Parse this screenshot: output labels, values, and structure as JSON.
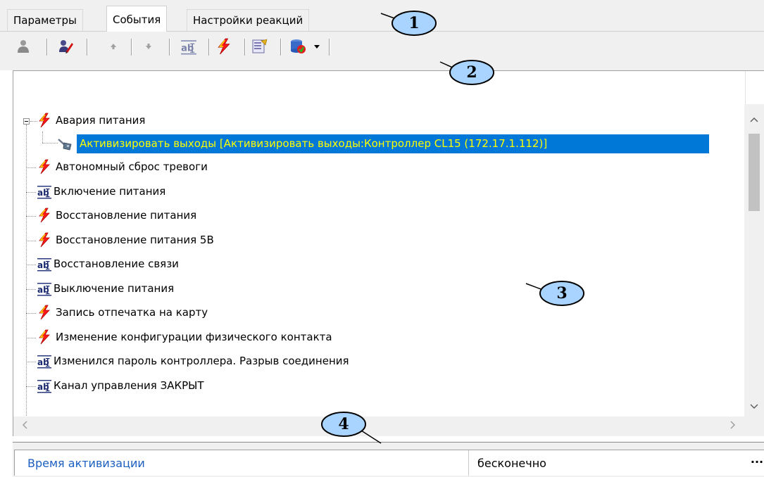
{
  "tabs": [
    {
      "label": "Параметры"
    },
    {
      "label": "События"
    },
    {
      "label": "Настройки реакций"
    }
  ],
  "callouts": [
    "1",
    "2",
    "3",
    "4"
  ],
  "toolbar": {
    "buttons": [
      "person-icon",
      "edit-icon",
      "move-up-icon",
      "move-down-icon",
      "text-event-icon",
      "lightning-icon",
      "properties-icon",
      "database-icon"
    ]
  },
  "tree": {
    "parent": {
      "label": "Авария питания",
      "icon": "lightning-icon"
    },
    "child": {
      "label": "Активизировать выходы [Активизировать выходы:Контроллер CL15 (172.17.1.112)]",
      "icon": "reaction-icon"
    },
    "items": [
      {
        "label": "Автономный сброс тревоги",
        "icon": "lightning-icon"
      },
      {
        "label": "Включение питания",
        "icon": "text-event-icon"
      },
      {
        "label": "Восстановление питания",
        "icon": "lightning-icon"
      },
      {
        "label": "Восстановление питания 5В",
        "icon": "lightning-icon"
      },
      {
        "label": "Восстановление связи",
        "icon": "text-event-icon"
      },
      {
        "label": "Выключение питания",
        "icon": "text-event-icon"
      },
      {
        "label": "Запись отпечатка на карту",
        "icon": "lightning-icon"
      },
      {
        "label": "Изменение конфигурации физического контакта",
        "icon": "lightning-icon"
      },
      {
        "label": "Изменился пароль контроллера. Разрыв соединения",
        "icon": "text-event-icon"
      },
      {
        "label": "Канал управления ЗАКРЫТ",
        "icon": "text-event-icon"
      }
    ]
  },
  "property": {
    "name": "Время активизации",
    "value": "бесконечно",
    "button": "..."
  },
  "colors": {
    "selection": "#0078d7",
    "selection_text": "#ffff00",
    "property_name": "#1b5fc1",
    "callout_fill": "#a8d4ff"
  }
}
